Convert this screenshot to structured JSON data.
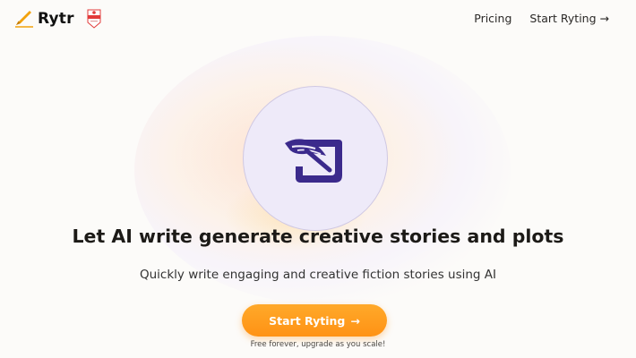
{
  "header": {
    "brand_name": "Rytr",
    "brand_icon": "pen-writing-icon",
    "badge_icon": "award-badge-icon",
    "nav": {
      "pricing_label": "Pricing",
      "start_label": "Start Ryting",
      "start_arrow": "→"
    }
  },
  "hero": {
    "icon": "story-scroll-quill-icon",
    "icon_color": "#3b2a8c",
    "title": "Let AI write generate creative stories and plots",
    "subtitle": "Quickly write engaging and creative fiction stories using AI",
    "cta_label": "Start Ryting",
    "cta_arrow": "→",
    "cta_color": "#ff9c20",
    "note": "Free forever, upgrade as you scale!"
  }
}
